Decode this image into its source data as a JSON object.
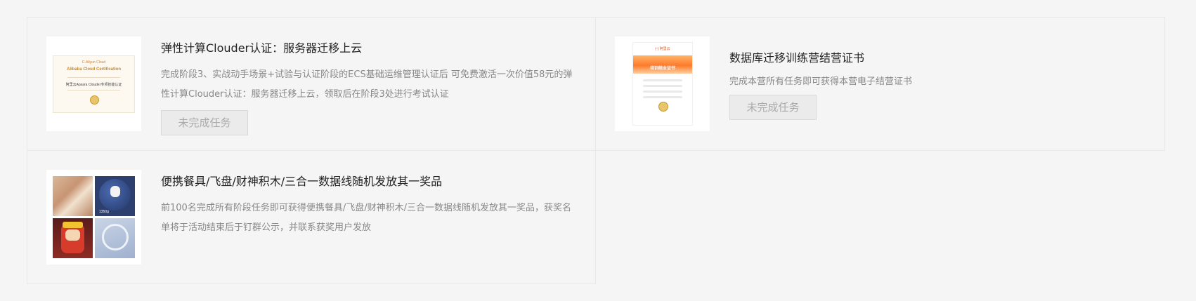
{
  "rewards": [
    {
      "title": "弹性计算Clouder认证：服务器迁移上云",
      "description": "完成阶段3、实战动手场景+试验与认证阶段的ECS基础运维管理认证后 可免费激活一次价值58元的弹性计算Clouder认证：服务器迁移上云，领取后在阶段3处进行考试认证",
      "button_label": "未完成任务",
      "thumb": {
        "brand": "C-Aliyun Cloud",
        "heading": "Alibaba Cloud Certification",
        "name_line": "阿里云Apsara Clouder专项技能认证"
      }
    },
    {
      "title": "数据库迁移训练营结营证书",
      "description": "完成本营所有任务即可获得本营电子结营证书",
      "button_label": "未完成任务",
      "thumb": {
        "brand": "(-) 阿里云",
        "heading": "培训结业证书"
      }
    },
    {
      "title": "便携餐具/飞盘/财神积木/三合一数据线随机发放其一奖品",
      "description": "前100名完成所有阶段任务即可获得便携餐具/飞盘/财神积木/三合一数据线随机发放其一奖品，获奖名单将于活动结束后于钉群公示，并联系获奖用户发放",
      "thumb": {
        "caption": "1350g"
      }
    }
  ],
  "colors": {
    "page_bg": "#f5f5f5",
    "border": "#e8e8e8",
    "title": "#222222",
    "desc": "#888888",
    "button_bg": "#ebebeb",
    "button_text": "#aaaaaa"
  }
}
